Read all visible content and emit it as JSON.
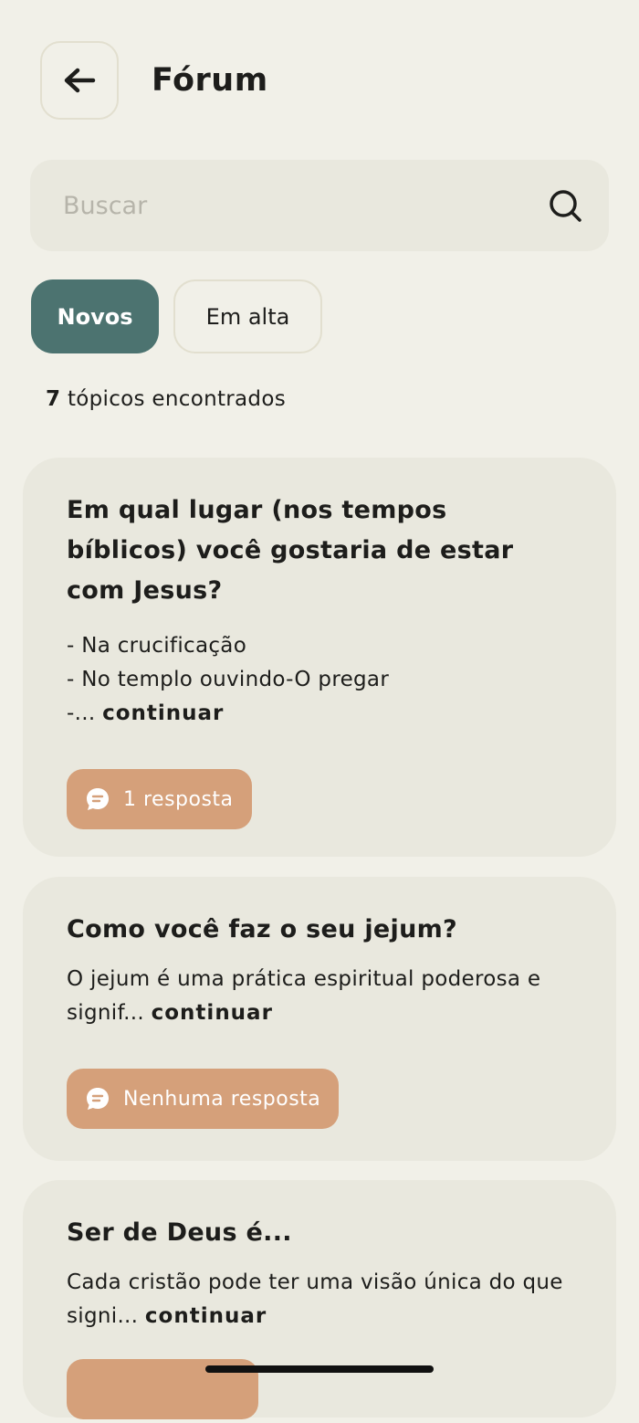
{
  "header": {
    "title": "Fórum",
    "back_icon": "arrow-left-icon"
  },
  "search": {
    "placeholder": "Buscar",
    "value": "",
    "icon": "search-icon"
  },
  "tabs": [
    {
      "label": "Novos",
      "active": true
    },
    {
      "label": "Em alta",
      "active": false
    }
  ],
  "results": {
    "count": "7",
    "label": "tópicos encontrados"
  },
  "topics": [
    {
      "title": "Em qual lugar (nos tempos bíblicos) você gostaria de estar com Jesus?",
      "excerpt": "- Na crucificação\n- No templo ouvindo-O pregar\n-...",
      "continue_label": "continuar",
      "replies": "1 resposta"
    },
    {
      "title": "Como você faz o seu jejum?",
      "excerpt": "O jejum é uma prática espiritual poderosa e signif...",
      "continue_label": "continuar",
      "replies": "Nenhuma resposta"
    },
    {
      "title": "Ser de Deus é...",
      "excerpt": "Cada cristão pode ter uma visão única do que signi...",
      "continue_label": "continuar",
      "replies": ""
    }
  ],
  "colors": {
    "background": "#f1f0e8",
    "card": "#e9e8de",
    "accent": "#4c7370",
    "badge": "#d5a07a"
  }
}
